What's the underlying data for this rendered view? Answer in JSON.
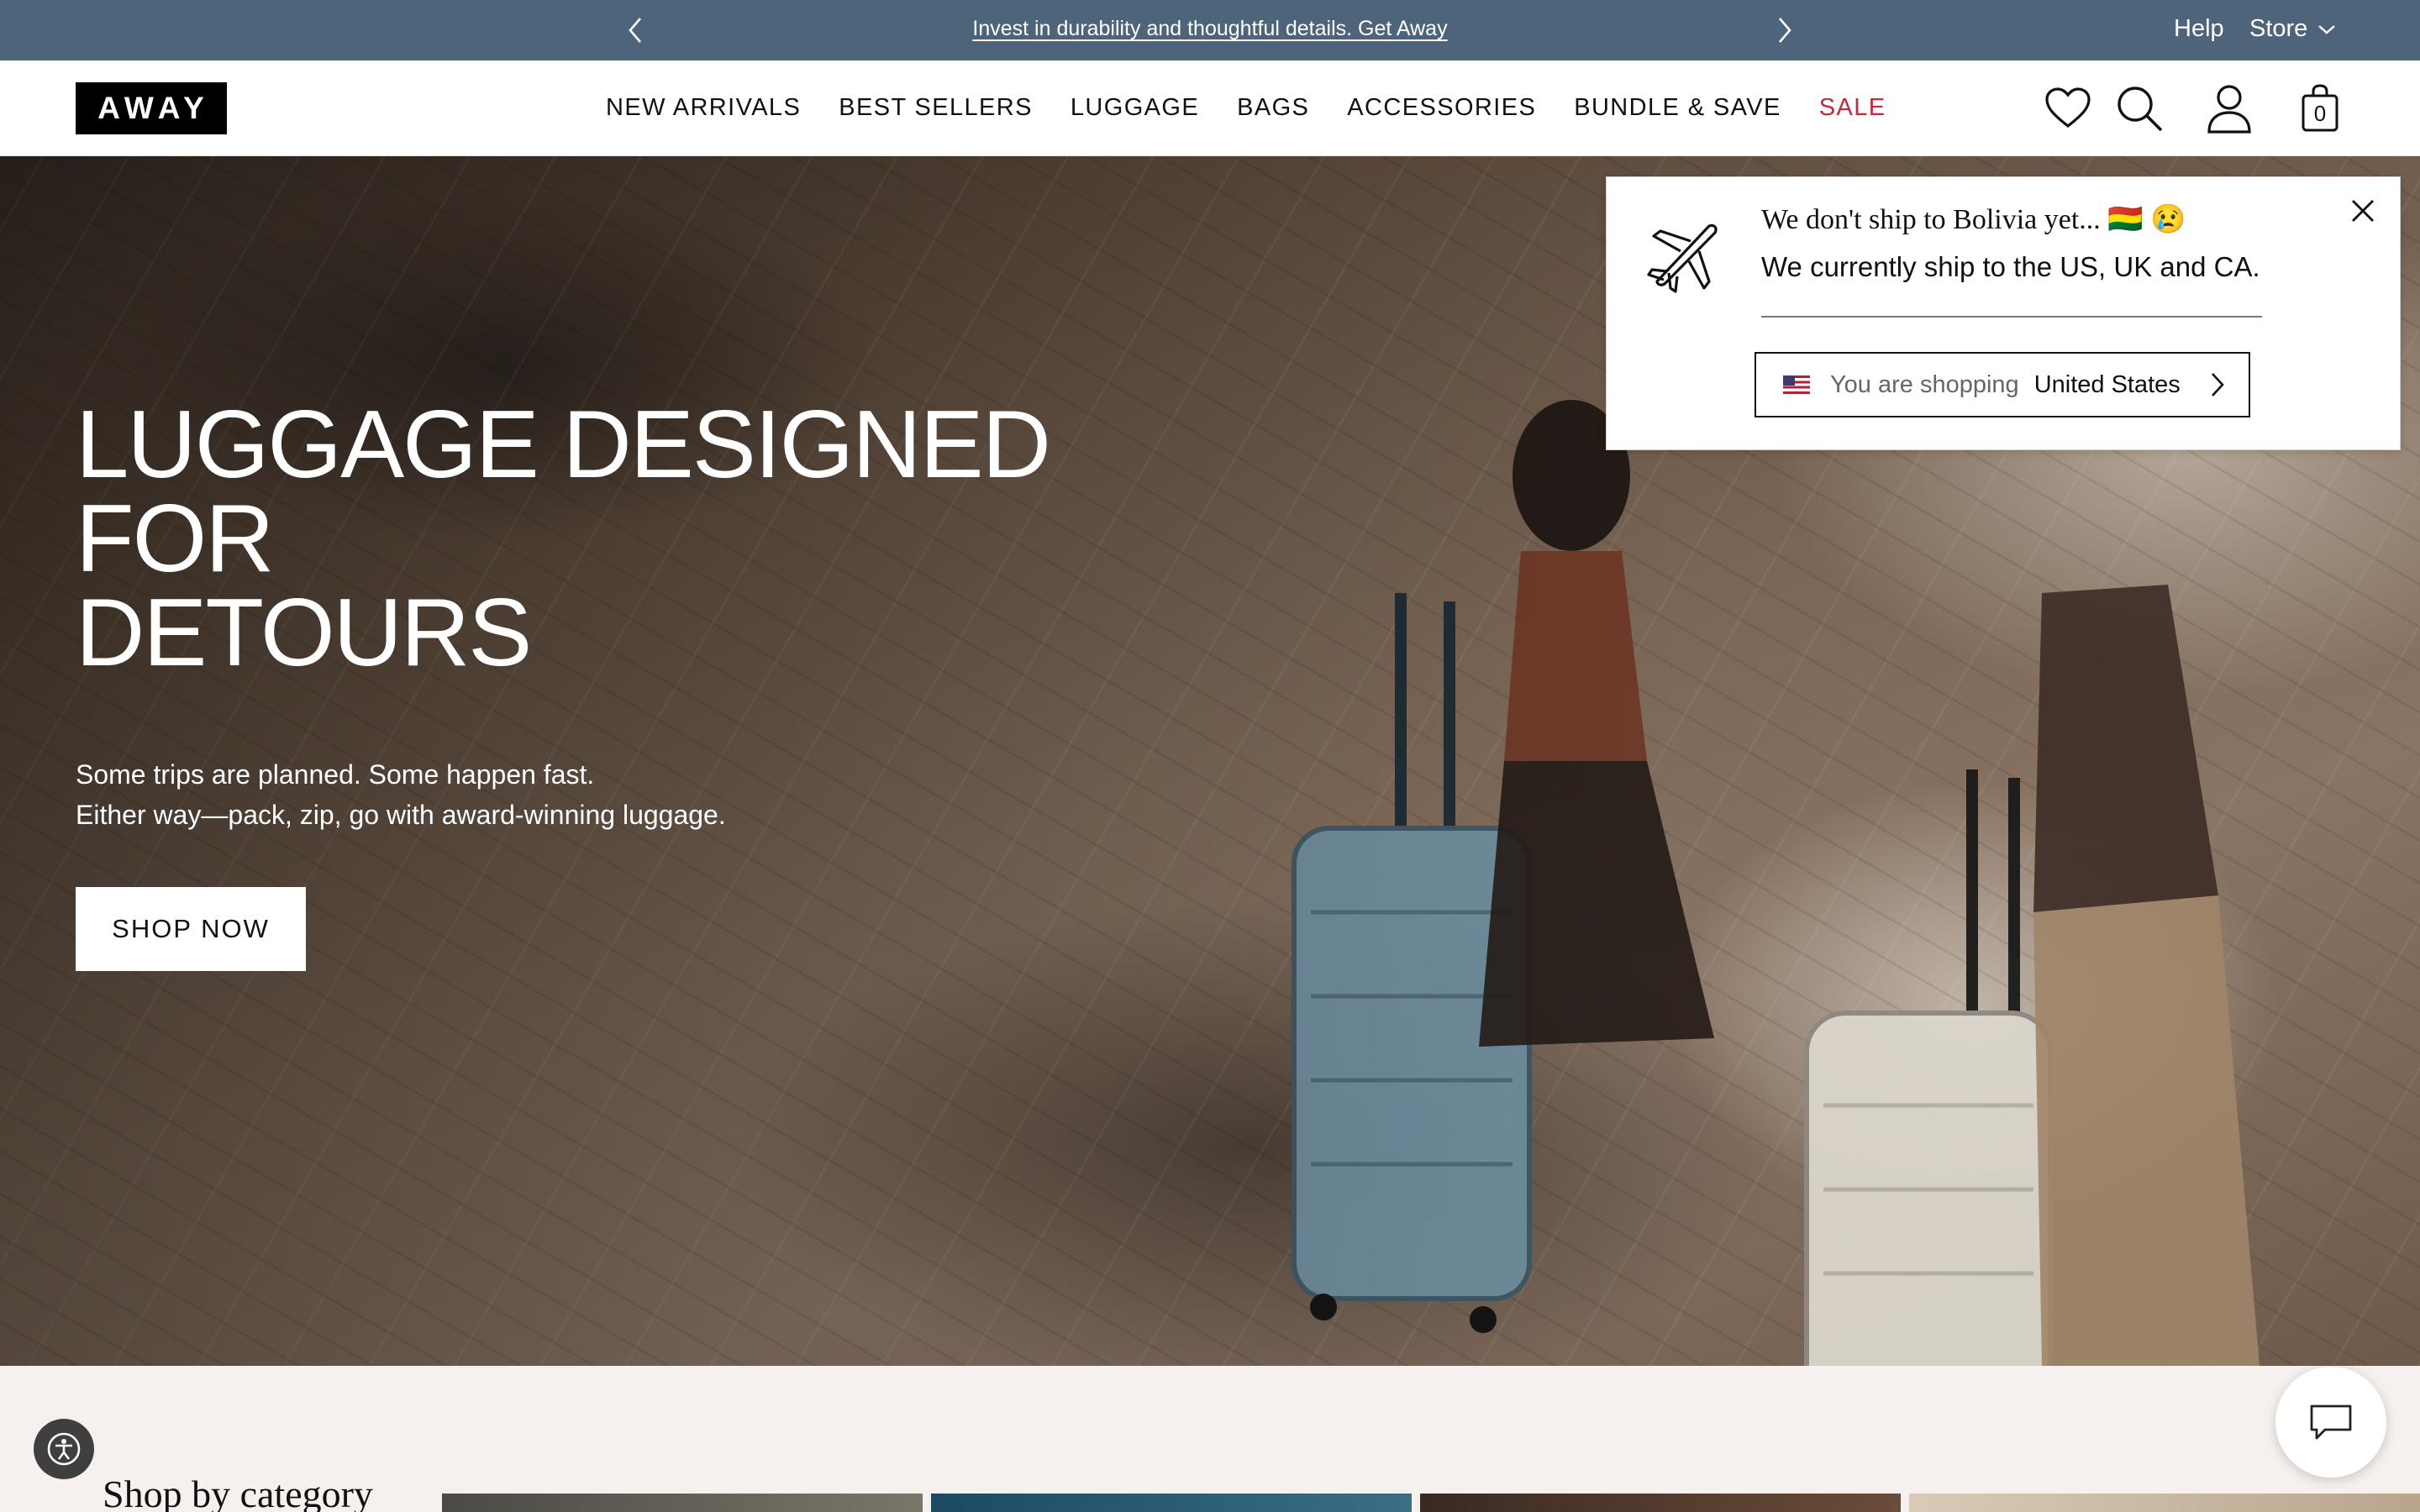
{
  "announcement": {
    "text": "Invest in durability and thoughtful details. Get Away",
    "help": "Help",
    "store": "Store"
  },
  "brand": {
    "logo": "AWAY"
  },
  "nav": {
    "items": [
      "NEW ARRIVALS",
      "BEST SELLERS",
      "LUGGAGE",
      "BAGS",
      "ACCESSORIES",
      "BUNDLE & SAVE",
      "SALE"
    ],
    "cart_count": "0"
  },
  "hero": {
    "title_line1": "LUGGAGE DESIGNED FOR",
    "title_line2": "DETOURS",
    "subtitle_line1": "Some trips are planned. Some happen fast.",
    "subtitle_line2": "Either way—pack, zip, go with award-winning luggage.",
    "cta": "SHOP NOW"
  },
  "shipping_popup": {
    "title": "We don't ship to Bolivia yet... 🇧🇴  😢",
    "body": "We currently ship to the US, UK and CA.",
    "selector_prefix": "You are shopping",
    "selector_value": "United States"
  },
  "category_section": {
    "title": "Shop by category"
  },
  "colors": {
    "promo_bg": "#4d647a",
    "sale": "#c5283d",
    "page_bg": "#f6f1ef"
  },
  "icons": [
    "chevron-left-icon",
    "chevron-right-icon",
    "chevron-down-icon",
    "heart-icon",
    "search-icon",
    "account-icon",
    "bag-icon",
    "close-icon",
    "airplane-icon",
    "accessibility-icon",
    "chat-icon"
  ]
}
